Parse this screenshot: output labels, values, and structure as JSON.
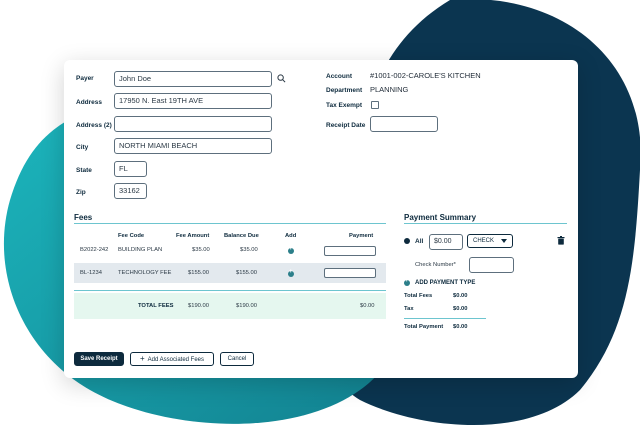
{
  "colors": {
    "navy": "#0d2a3d",
    "teal": "#18a8b3",
    "accent": "#2c7f8a",
    "row": "#e3e9ee",
    "total": "#e5f7ef"
  },
  "payer": {
    "payer_label": "Payer",
    "payer_value": "John Doe",
    "address_label": "Address",
    "address_value": "17950 N. East 19TH AVE",
    "address2_label": "Address (2)",
    "address2_value": "",
    "city_label": "City",
    "city_value": "NORTH MIAMI BEACH",
    "state_label": "State",
    "state_value": "FL",
    "zip_label": "Zip",
    "zip_value": "33162"
  },
  "account": {
    "account_label": "Account",
    "account_value": "#1001-002-CAROLE'S KITCHEN",
    "department_label": "Department",
    "department_value": "PLANNING",
    "tax_exempt_label": "Tax Exempt",
    "receipt_date_label": "Receipt Date",
    "receipt_date_value": ""
  },
  "fees": {
    "title": "Fees",
    "headers": {
      "fee_code": "Fee Code",
      "fee_amount": "Fee Amount",
      "balance_due": "Balance Due",
      "add": "Add",
      "payment": "Payment"
    },
    "rows": [
      {
        "id": "B2022-242",
        "fee_code": "BUILDING PLAN",
        "fee_amount": "$35.00",
        "balance_due": "$35.00"
      },
      {
        "id": "BL-1234",
        "fee_code": "TECHNOLOGY FEE",
        "fee_amount": "$155.00",
        "balance_due": "$155.00"
      }
    ],
    "total_label": "TOTAL FEES",
    "total_amount": "$190.00",
    "total_balance": "$190.00",
    "total_payment": "$0.00"
  },
  "payment_summary": {
    "title": "Payment Summary",
    "all_label": "All",
    "all_amount": "$0.00",
    "method_selected": "CHECK",
    "check_number_label": "Check Number*",
    "add_payment_type_label": "ADD PAYMENT TYPE",
    "total_fees_label": "Total Fees",
    "total_fees_value": "$0.00",
    "tax_label": "Tax",
    "tax_value": "$0.00",
    "total_payment_label": "Total Payment",
    "total_payment_value": "$0.00"
  },
  "actions": {
    "save_label": "Save Receipt",
    "add_fees_icon": "+",
    "add_fees_label": "Add Associated Fees",
    "cancel_label": "Cancel"
  },
  "icons": {
    "search": "search-icon",
    "trash": "trash-icon",
    "add": "add-circle-icon",
    "dropdown": "chevron-down-icon"
  }
}
